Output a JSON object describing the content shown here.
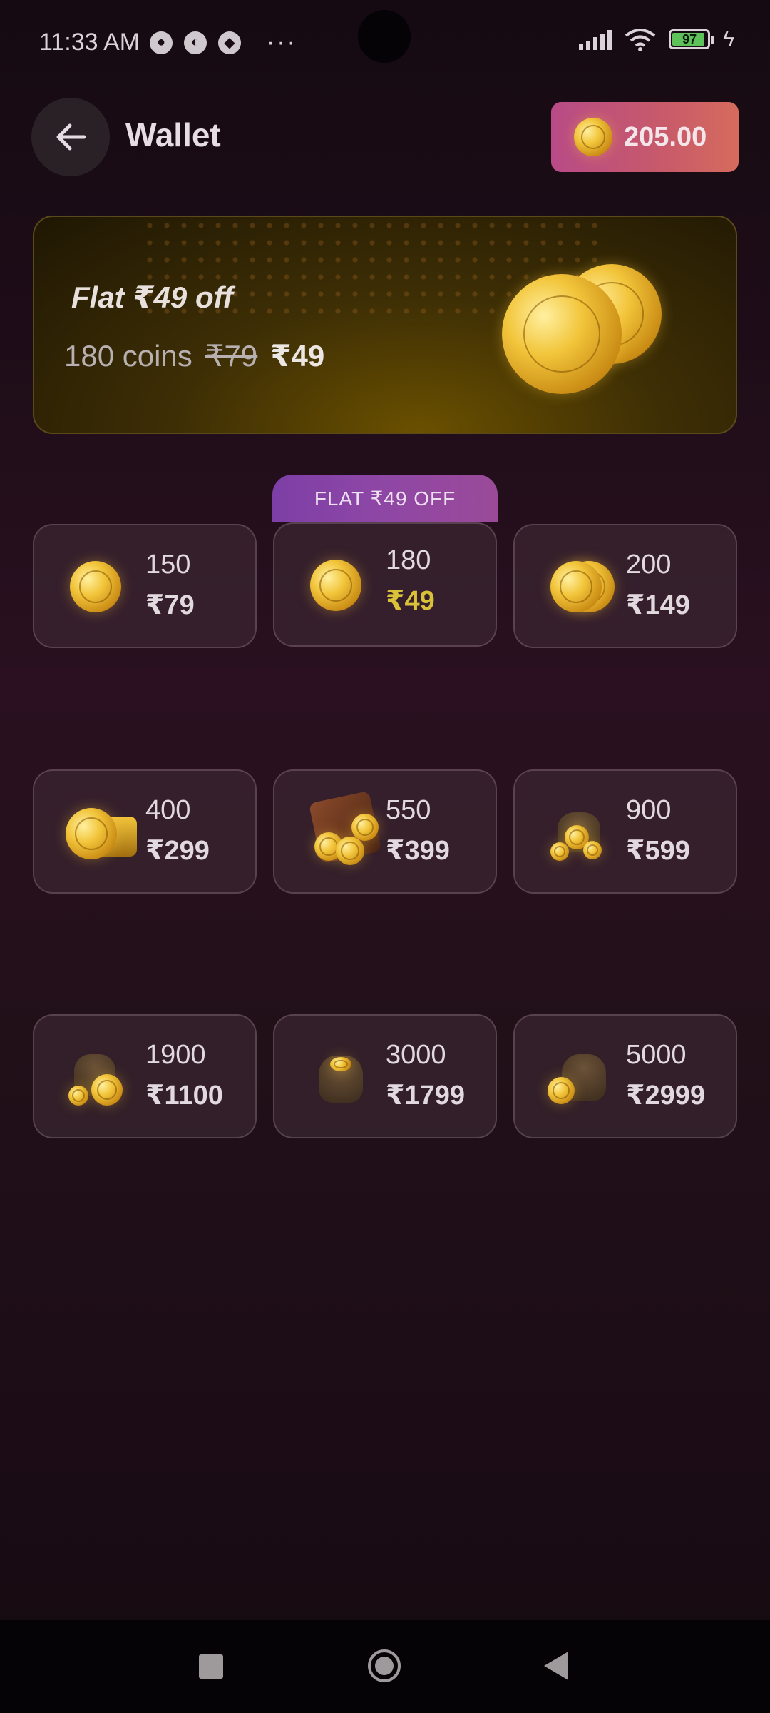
{
  "status_bar": {
    "time": "11:33 AM",
    "battery": "97"
  },
  "header": {
    "title": "Wallet",
    "balance": "205.00"
  },
  "promo": {
    "headline": "Flat ₹49 off",
    "coins_text": "180 coins",
    "old_price": "₹79",
    "new_price": "₹49"
  },
  "offer_tag": "FLAT ₹49 OFF",
  "packs": [
    {
      "coins": "150",
      "price": "₹79"
    },
    {
      "coins": "180",
      "price": "₹49"
    },
    {
      "coins": "200",
      "price": "₹149"
    },
    {
      "coins": "400",
      "price": "₹299"
    },
    {
      "coins": "550",
      "price": "₹399"
    },
    {
      "coins": "900",
      "price": "₹599"
    },
    {
      "coins": "1900",
      "price": "₹1100"
    },
    {
      "coins": "3000",
      "price": "₹1799"
    },
    {
      "coins": "5000",
      "price": "₹2999"
    }
  ],
  "colors": {
    "balance_gradient_start": "#b84b87",
    "balance_gradient_end": "#d66b5d",
    "offer_tag": "#8f47a5",
    "discount_price": "#d9c23a"
  }
}
